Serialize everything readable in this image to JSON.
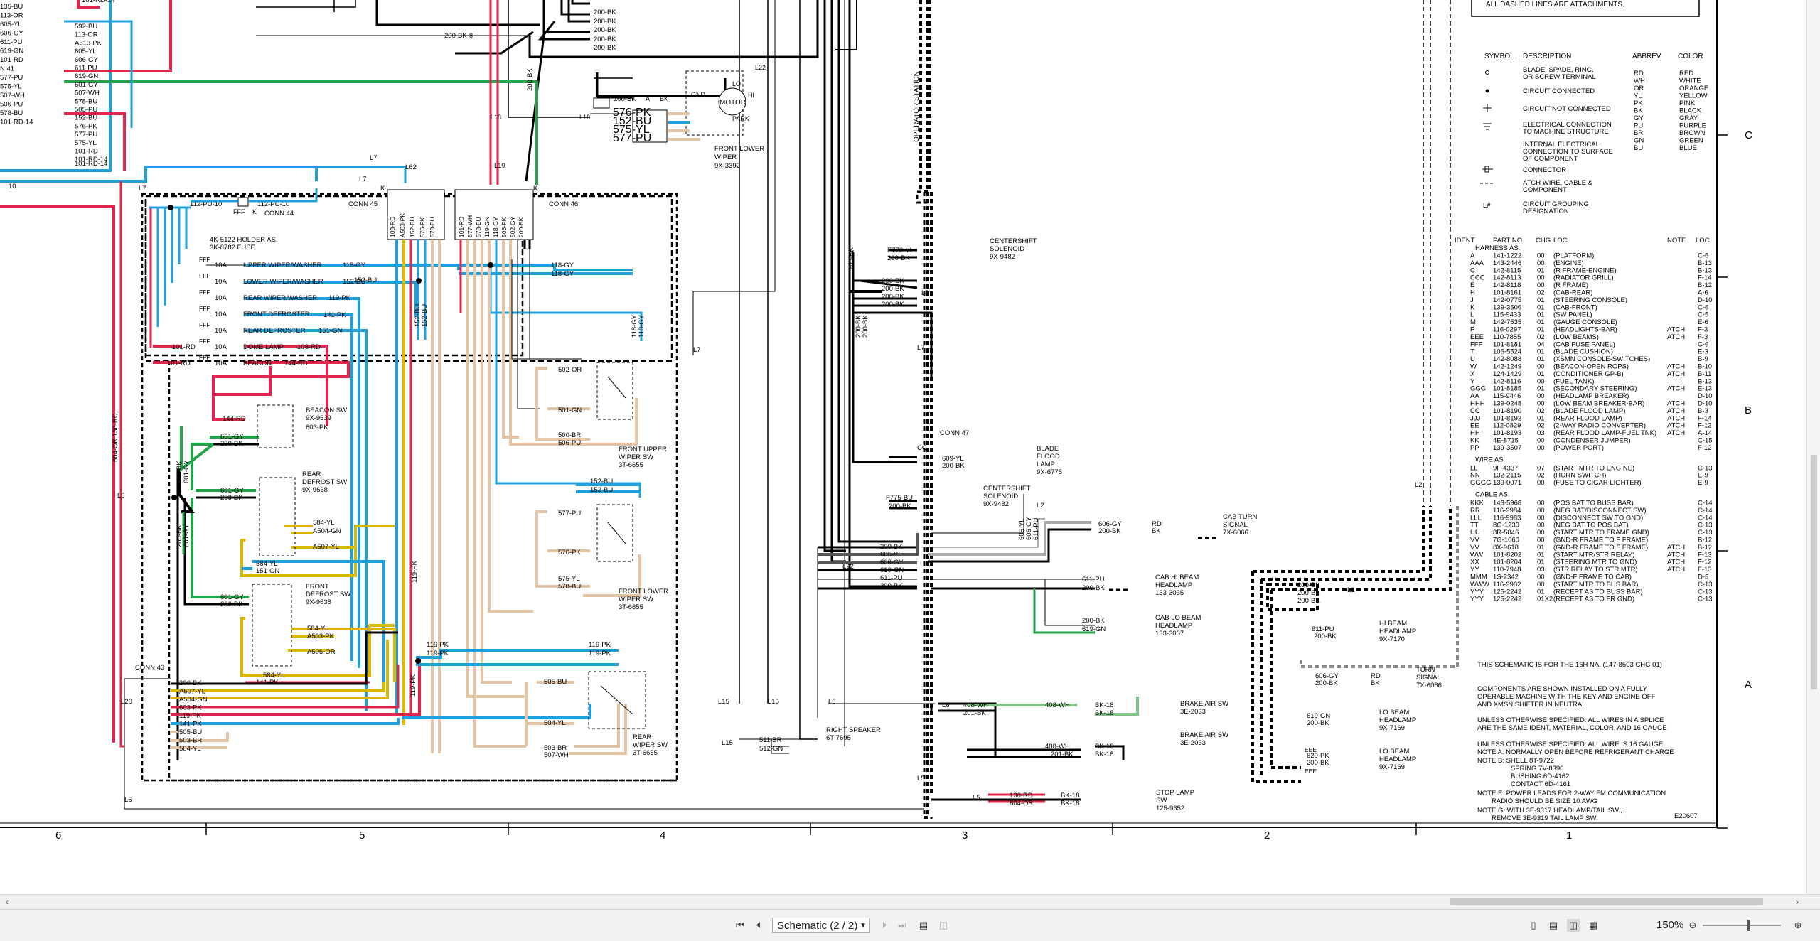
{
  "legend": {
    "dashed_note": "ALL DASHED LINES ARE ATTACHMENTS.",
    "headers": {
      "symbol": "SYMBOL",
      "description": "DESCRIPTION",
      "abbrev": "ABBREV",
      "color": "COLOR"
    },
    "symbols": [
      {
        "desc": "BLADE, SPADE, RING,",
        "desc2": "OR SCREW TERMINAL"
      },
      {
        "desc": "CIRCUIT CONNECTED",
        "desc2": ""
      },
      {
        "desc": "CIRCUIT NOT CONNECTED",
        "desc2": ""
      },
      {
        "desc": "ELECTRICAL CONNECTION",
        "desc2": "TO MACHINE STRUCTURE"
      },
      {
        "desc": "INTERNAL ELECTRICAL",
        "desc2": "CONNECTION TO SURFACE",
        "desc3": "OF COMPONENT"
      },
      {
        "desc": "CONNECTOR",
        "desc2": ""
      },
      {
        "desc": "ATCH WIRE, CABLE &",
        "desc2": "COMPONENT"
      },
      {
        "desc": "CIRCUIT GROUPING",
        "desc2": "DESIGNATION",
        "sym": "L#"
      }
    ],
    "colors": [
      [
        "RD",
        "RED"
      ],
      [
        "WH",
        "WHITE"
      ],
      [
        "OR",
        "ORANGE"
      ],
      [
        "YL",
        "YELLOW"
      ],
      [
        "PK",
        "PINK"
      ],
      [
        "BK",
        "BLACK"
      ],
      [
        "GY",
        "GRAY"
      ],
      [
        "PU",
        "PURPLE"
      ],
      [
        "BR",
        "BROWN"
      ],
      [
        "GN",
        "GREEN"
      ],
      [
        "BU",
        "BLUE"
      ]
    ]
  },
  "ident_table": {
    "headers": [
      "IDENT",
      "PART NO.",
      "CHG",
      "LOC",
      "NOTE",
      "LOC"
    ],
    "harness_title": "HARNESS AS.",
    "harness": [
      [
        "A",
        "141-1222",
        "00",
        "(PLATFORM)",
        "",
        "C-6"
      ],
      [
        "AAA",
        "143-2446",
        "00",
        "(ENGINE)",
        "",
        "B-13"
      ],
      [
        "C",
        "142-8115",
        "01",
        "(R FRAME-ENGINE)",
        "",
        "B-13"
      ],
      [
        "CCC",
        "142-8113",
        "00",
        "(RADIATOR GRILL)",
        "",
        "F-14"
      ],
      [
        "E",
        "142-8118",
        "00",
        "(R FRAME)",
        "",
        "B-12"
      ],
      [
        "H",
        "101-8161",
        "02",
        "(CAB-REAR)",
        "",
        "A-6"
      ],
      [
        "J",
        "142-0775",
        "01",
        "(STEERING CONSOLE)",
        "",
        "D-10"
      ],
      [
        "K",
        "139-3506",
        "01",
        "(CAB-FRONT)",
        "",
        "C-6"
      ],
      [
        "L",
        "115-9433",
        "01",
        "(SW PANEL)",
        "",
        "C-5"
      ],
      [
        "M",
        "142-7535",
        "01",
        "(GAUGE CONSOLE)",
        "",
        "E-6"
      ],
      [
        "P",
        "116-0297",
        "01",
        "(HEADLIGHTS-BAR)",
        "ATCH",
        "F-3"
      ],
      [
        "EEE",
        "110-7855",
        "02",
        "(LOW BEAMS)",
        "ATCH",
        "F-3"
      ],
      [
        "FFF",
        "101-8181",
        "04",
        "(CAB FUSE PANEL)",
        "",
        "C-6"
      ],
      [
        "T",
        "106-5524",
        "01",
        "(BLADE CUSHION)",
        "",
        "E-3"
      ],
      [
        "U",
        "142-8088",
        "01",
        "(XSMN CONSOLE-SWITCHES)",
        "",
        "B-9"
      ],
      [
        "W",
        "142-1249",
        "00",
        "(BEACON-OPEN ROPS)",
        "ATCH",
        "B-10"
      ],
      [
        "X",
        "124-1429",
        "01",
        "(CONDITIONER GP-B)",
        "ATCH",
        "B-11"
      ],
      [
        "Y",
        "142-8116",
        "00",
        "(FUEL TANK)",
        "",
        "B-13"
      ],
      [
        "GGG",
        "101-8185",
        "01",
        "(SECONDARY STEERING)",
        "ATCH",
        "E-13"
      ],
      [
        "AA",
        "115-9446",
        "00",
        "(HEADLAMP BREAKER)",
        "",
        "D-10"
      ],
      [
        "HHH",
        "139-0248",
        "00",
        "(LOW BEAM BREAKER-BAR)",
        "ATCH",
        "D-10"
      ],
      [
        "CC",
        "101-8190",
        "02",
        "(BLADE FLOOD LAMP)",
        "ATCH",
        "B-3"
      ],
      [
        "JJJ",
        "101-8192",
        "01",
        "(REAR FLOOD LAMP)",
        "ATCH",
        "F-14"
      ],
      [
        "EE",
        "112-0829",
        "02",
        "(2-WAY RADIO CONVERTER)",
        "ATCH",
        "F-12"
      ],
      [
        "HH",
        "101-8193",
        "03",
        "(REAR FLOOD LAMP-FUEL TNK)",
        "ATCH",
        "A-14"
      ],
      [
        "KK",
        "4E-8715",
        "00",
        "(CONDENSER JUMPER)",
        "",
        "C-15"
      ],
      [
        "PP",
        "139-3507",
        "00",
        "(POWER PORT)",
        "",
        "F-12"
      ]
    ],
    "wire_title": "WIRE AS.",
    "wire": [
      [
        "LL",
        "9F-4337",
        "07",
        "(START MTR TO ENGINE)",
        "",
        "C-13"
      ],
      [
        "NN",
        "132-2115",
        "02",
        "(HORN SWITCH)",
        "",
        "E-9"
      ],
      [
        "GGGG",
        "139-0071",
        "00",
        "(FUSE TO CIGAR LIGHTER)",
        "",
        "E-9"
      ]
    ],
    "cable_title": "CABLE AS.",
    "cable": [
      [
        "KKK",
        "143-5968",
        "00",
        "(POS BAT TO BUSS BAR)",
        "",
        "C-14"
      ],
      [
        "RR",
        "116-9984",
        "00",
        "(NEG BAT/DISCONNECT SW)",
        "",
        "C-14"
      ],
      [
        "LLL",
        "116-9983",
        "00",
        "(DISCONNECT SW TO GND)",
        "",
        "C-14"
      ],
      [
        "TT",
        "8G-1230",
        "00",
        "(NEG BAT TO POS BAT)",
        "",
        "C-13"
      ],
      [
        "UU",
        "8R-5846",
        "00",
        "(START MTR TO FRAME GND)",
        "",
        "C-13"
      ],
      [
        "VV",
        "7G-1060",
        "00",
        "(GND-R FRAME TO F FRAME)",
        "",
        "B-12"
      ],
      [
        "VV",
        "8X-9618",
        "01",
        "(GND-R FRAME TO F FRAME)",
        "ATCH",
        "B-12"
      ],
      [
        "WW",
        "101-8202",
        "01",
        "(START MTR/STR RELAY)",
        "ATCH",
        "F-13"
      ],
      [
        "XX",
        "101-8204",
        "01",
        "(STEERING MTR TO GND)",
        "ATCH",
        "F-12"
      ],
      [
        "YY",
        "110-7948",
        "03",
        "(STR RELAY TO STR MTR)",
        "ATCH",
        "F-13"
      ],
      [
        "MMM",
        "1S-2342",
        "00",
        "(GND-F FRAME TO CAB)",
        "",
        "D-5"
      ],
      [
        "WWW",
        "116-9982",
        "00",
        "(START MTR TO BUS BAR)",
        "",
        "C-13"
      ],
      [
        "YYY",
        "125-2242",
        "01",
        "(RECEPT AS TO BUSS BAR)",
        "",
        "C-13"
      ],
      [
        "YYY",
        "125-2242",
        "01X2",
        "(RECEPT AS TO FR GND)",
        "",
        "C-13"
      ]
    ]
  },
  "notes": {
    "line1": "THIS SCHEMATIC IS FOR THE 16H NA. (147-8503 CHG 01)",
    "line2a": "COMPONENTS ARE SHOWN INSTALLED ON A FULLY",
    "line2b": "OPERABLE MACHINE WITH THE KEY AND ENGINE OFF",
    "line2c": "AND XMSN SHIFTER IN NEUTRAL",
    "line3a": "UNLESS OTHERWISE SPECIFIED: ALL WIRES IN A SPLICE",
    "line3b": "ARE THE SAME IDENT, MATERIAL, COLOR, AND 16 GAUGE",
    "line4": "UNLESS OTHERWISE SPECIFIED: ALL WIRE IS 16 GAUGE",
    "line5": "NOTE A: NORMALLY OPEN BEFORE REFRIGERANT CHARGE",
    "line6a": "NOTE B:    SHELL      8T-9722",
    "line6b": "SPRING     7V-8390",
    "line6c": "BUSHING    6D-4162",
    "line6d": "CONTACT    6D-4161",
    "line7a": "NOTE E: POWER LEADS FOR 2-WAY FM COMMUNICATION",
    "line7b": "RADIO SHOULD BE SIZE 10 AWG",
    "line8a": "NOTE G: WITH 3E-9317 HEADLAMP/TAIL SW.,",
    "line8b": "REMOVE 3E-9319 TAIL LAMP SW.",
    "drawing_no": "E20607"
  },
  "grid": {
    "bottom": [
      "6",
      "5",
      "4",
      "3",
      "2",
      "1"
    ],
    "right": [
      "C",
      "B",
      "A"
    ]
  },
  "components": {
    "operator_station": "OPERATOR STATION",
    "conn44": "CONN 44",
    "conn45": "CONN 45",
    "conn46": "CONN 46",
    "conn47": "CONN 47",
    "conn43": "CONN 43",
    "fuse_holder": [
      "4K-5122 HOLDER AS.",
      "3K-8782 FUSE"
    ],
    "fuses": [
      "UPPER WIPER/WASHER",
      "LOWER WIPER/WASHER",
      "REAR WIPER/WASHER",
      "FRONT DEFROSTER",
      "REAR DEFROSTER",
      "DOME LAMP",
      "BEACON"
    ],
    "fuse_rating": "10A",
    "fuse_wires": [
      "118-GY",
      "152-BU",
      "119-PK",
      "141-PK",
      "151-GN",
      "108-RD",
      "144-RD"
    ],
    "beacon_sw": [
      "BEACON SW",
      "9X-9639"
    ],
    "rear_defrost_sw": [
      "REAR",
      "DEFROST SW",
      "9X-9638"
    ],
    "front_defrost_sw": [
      "FRONT",
      "DEFROST SW",
      "9X-9638"
    ],
    "front_upper_wiper_sw": [
      "FRONT UPPER",
      "WIPER SW",
      "3T-6655"
    ],
    "front_lower_wiper_sw": [
      "FRONT LOWER",
      "WIPER SW",
      "3T-6655"
    ],
    "rear_wiper_sw": [
      "REAR",
      "WIPER SW",
      "3T-6655"
    ],
    "front_lower_wiper": [
      "FRONT LOWER",
      "WIPER",
      "9X-3392"
    ],
    "motor": "MOTOR",
    "centershift1": [
      "CENTERSHIFT",
      "SOLENOID",
      "9X-9482"
    ],
    "centershift2": [
      "CENTERSHIFT",
      "SOLENOID",
      "9X-9482"
    ],
    "blade_flood_lamp": [
      "BLADE",
      "FLOOD",
      "LAMP",
      "9X-6775"
    ],
    "cab_turn_signal": [
      "CAB TURN",
      "SIGNAL",
      "7X-6066"
    ],
    "cab_hi_beam": [
      "CAB HI BEAM",
      "HEADLAMP",
      "133-3035"
    ],
    "cab_lo_beam": [
      "CAB LO BEAM",
      "HEADLAMP",
      "133-3037"
    ],
    "hi_beam": [
      "HI BEAM",
      "HEADLAMP",
      "9X-7170"
    ],
    "turn_signal": [
      "TURN",
      "SIGNAL",
      "7X-6066"
    ],
    "lo_beam1": [
      "LO BEAM",
      "HEADLAMP",
      "9X-7169"
    ],
    "lo_beam2": [
      "LO BEAM",
      "HEADLAMP",
      "9X-7169"
    ],
    "brake_air_sw1": [
      "BRAKE AIR SW",
      "3E-2033"
    ],
    "brake_air_sw2": [
      "BRAKE AIR SW",
      "3E-2033"
    ],
    "right_speaker": [
      "RIGHT SPEAKER",
      "6T-7695"
    ],
    "stop_lamp_sw": [
      "STOP LAMP",
      "SW",
      "125-9352"
    ],
    "wires": {
      "w200bk": "200-BK",
      "w200bk8": "200-BK-8",
      "w601gy": "601-GY",
      "w603pk": "603-PK",
      "w584yl": "584-YL",
      "wA504gn": "A504-GN",
      "wA507yl": "A507-YL",
      "w151gn": "151-GN",
      "wA503pk": "A503-PK",
      "wA506or": "A506-OR",
      "w141pk": "141-PK",
      "w502or": "502-OR",
      "w501gn": "501-GN",
      "w500br": "500-BR",
      "w506pu": "506-PU",
      "w577pu": "577-PU",
      "w576pk": "576-PK",
      "w575yl": "575-YL",
      "w578bu": "578-BU",
      "w505bu": "505-BU",
      "w504yl": "504-YL",
      "w503br": "503-BR",
      "w507wh": "507-WH",
      "w119pk": "119-PK",
      "wE773yl": "E773-YL",
      "wF775bu": "F775-BU",
      "w609yl": "609-YL",
      "w605yl": "605-YL",
      "w606gy": "606-GY",
      "w619gn": "619-GN",
      "w611pu": "611-PU",
      "w629pk": "629-PK",
      "w408wh": "408-WH",
      "w201bk": "201-BK",
      "w488wh": "488-WH",
      "wbk18": "BK-18",
      "w511br": "511-BR",
      "w512gn": "512-GN",
      "w130rd": "130-RD",
      "w604or": "604-OR",
      "w112pu10": "112-PU-10",
      "w101rd": "101-RD",
      "w101rd14": "101-RD-14",
      "w144rd": "144-RD",
      "w108rd": "108-RD",
      "w135bu": "135-BU",
      "w592bu": "592-BU",
      "w113or": "113-OR",
      "wA513pk": "A513-PK",
      "w605yl2": "605-YL",
      "w606gy2": "606-GY",
      "w611pu2": "611-PU",
      "w619gn2": "619-GN",
      "w152bu": "152-BU",
      "w507wh2": "507-WH",
      "w118gy": "118-GY",
      "w604or130rd": "604-OR 130-RD"
    },
    "left_list": [
      "135-BU",
      "113-OR",
      "605-YL",
      "606-GY",
      "611-PU",
      "619-GN",
      "101-RD",
      "N 41",
      "577-PU",
      "575-YL",
      "507-WH",
      "506-PU",
      "578-BU",
      "101-RD-14"
    ],
    "left_list2": [
      "592-BU",
      "113-OR",
      "A513-PK",
      "605-YL",
      "606-GY",
      "611-PU",
      "619-GN",
      "601-GY",
      "507-WH",
      "578-BU",
      "505-PU",
      "152-BU",
      "576-PK",
      "577-PU",
      "575-YL",
      "101-RD",
      "101-RD-14"
    ],
    "top_left": "101-RD-14",
    "wiper_wires": [
      "576-PK",
      "152-BU",
      "575-YL",
      "577-PU"
    ],
    "motor_pins": [
      "GND",
      "LO",
      "HI",
      "PARK"
    ]
  },
  "viewer": {
    "page_label": "Schematic (2 / 2)",
    "zoom": "150%"
  }
}
